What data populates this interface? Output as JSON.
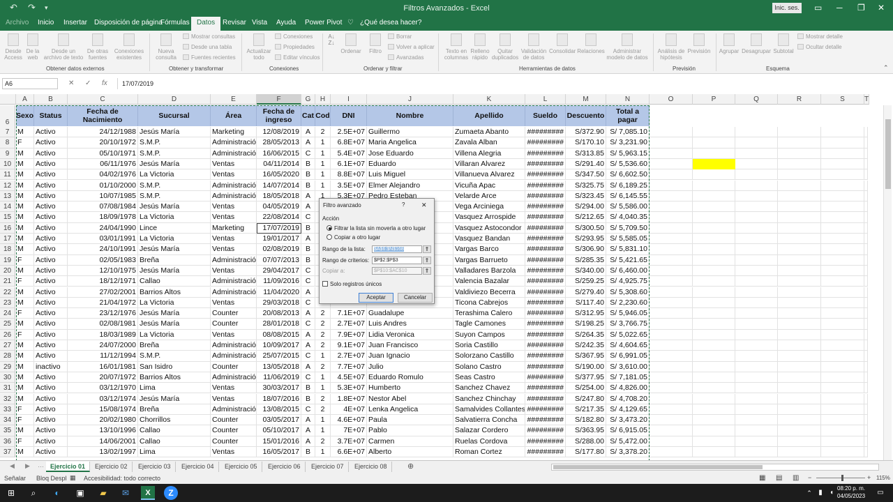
{
  "app": {
    "title": "Filtros Avanzados - Excel",
    "signin": "Inic. ses."
  },
  "tabs": [
    "Archivo",
    "Inicio",
    "Insertar",
    "Disposición de página",
    "Fórmulas",
    "Datos",
    "Revisar",
    "Vista",
    "Ayuda",
    "Power Pivot",
    "¿Qué desea hacer?"
  ],
  "ribbon": {
    "groups": {
      "g1": "Obtener datos externos",
      "g2": "Obtener y transformar",
      "g3": "Conexiones",
      "g4": "Ordenar y filtrar",
      "g5": "Herramientas de datos",
      "g6": "Previsión",
      "g7": "Esquema"
    },
    "btns": {
      "b1": "Desde Access",
      "b2": "De la web",
      "b3": "Desde un archivo de texto",
      "b4": "De otras fuentes",
      "b5": "Conexiones existentes",
      "b6": "Nueva consulta",
      "b7": "Mostrar consultas",
      "b8": "Desde una tabla",
      "b9": "Fuentes recientes",
      "b10": "Actualizar todo",
      "b11": "Conexiones",
      "b12": "Propiedades",
      "b13": "Editar vínculos",
      "b14": "Ordenar",
      "b15": "Filtro",
      "b16": "Borrar",
      "b17": "Volver a aplicar",
      "b18": "Avanzadas",
      "b19": "Texto en columnas",
      "b20": "Relleno rápido",
      "b21": "Quitar duplicados",
      "b22": "Validación de datos",
      "b23": "Consolidar",
      "b24": "Relaciones",
      "b25": "Administrar modelo de datos",
      "b26": "Análisis de hipótesis",
      "b27": "Previsión",
      "b28": "Agrupar",
      "b29": "Desagrupar",
      "b30": "Subtotal",
      "b31": "Mostrar detalle",
      "b32": "Ocultar detalle"
    }
  },
  "formula": {
    "namebox": "A6",
    "fx": "fx",
    "value": "17/07/2019"
  },
  "columns": [
    "A",
    "B",
    "C",
    "D",
    "E",
    "F",
    "G",
    "H",
    "I",
    "J",
    "K",
    "L",
    "M",
    "N",
    "O",
    "P",
    "Q",
    "R",
    "S",
    "T"
  ],
  "headers": [
    "Sexo",
    "Status",
    "Fecha de Nacimiento",
    "Sucursal",
    "Área",
    "Fecha de ingreso",
    "Cat",
    "Cod",
    "DNI",
    "Nombre",
    "Apellido",
    "Sueldo",
    "Descuento",
    "Total a pagar"
  ],
  "rows": [
    [
      "M",
      "Activo",
      "24/12/1988",
      "Jesús María",
      "Marketing",
      "12/08/2019",
      "A",
      "2",
      "2.5E+07",
      "Guillermo",
      "Zumaeta Abanto",
      "#########",
      "S/372.90",
      "S/ 7,085.10"
    ],
    [
      "F",
      "Activo",
      "20/10/1972",
      "S.M.P.",
      "Administración",
      "28/05/2013",
      "A",
      "1",
      "6.8E+07",
      "Maria Angelica",
      "Zavala Alban",
      "#########",
      "S/170.10",
      "S/ 3,231.90"
    ],
    [
      "M",
      "Activo",
      "05/10/1971",
      "S.M.P.",
      "Administración",
      "16/06/2015",
      "C",
      "1",
      "5.4E+07",
      "Jose Eduardo",
      "Villena Alegria",
      "#########",
      "S/313.85",
      "S/ 5,963.15"
    ],
    [
      "M",
      "Activo",
      "06/11/1976",
      "Jesús María",
      "Ventas",
      "04/11/2014",
      "B",
      "1",
      "6.1E+07",
      "Eduardo",
      "Villaran Alvarez",
      "#########",
      "S/291.40",
      "S/ 5,536.60"
    ],
    [
      "M",
      "Activo",
      "04/02/1976",
      "La Victoria",
      "Ventas",
      "16/05/2020",
      "B",
      "1",
      "8.8E+07",
      "Luis Miguel",
      "Villanueva Alvarez",
      "#########",
      "S/347.50",
      "S/ 6,602.50"
    ],
    [
      "M",
      "Activo",
      "01/10/2000",
      "S.M.P.",
      "Administración",
      "14/07/2014",
      "B",
      "1",
      "3.5E+07",
      "Elmer Alejandro",
      "Vicuña Apac",
      "#########",
      "S/325.75",
      "S/ 6,189.25"
    ],
    [
      "M",
      "Activo",
      "10/07/1985",
      "S.M.P.",
      "Administración",
      "18/05/2018",
      "A",
      "1",
      "5.3E+07",
      "Pedro Esteban",
      "Velarde Arce",
      "#########",
      "S/323.45",
      "S/ 6,145.55"
    ],
    [
      "M",
      "Activo",
      "07/08/1984",
      "Jesús María",
      "Ventas",
      "04/05/2019",
      "A",
      "",
      "",
      "",
      "Vega Arciniega",
      "#########",
      "S/294.00",
      "S/ 5,586.00"
    ],
    [
      "M",
      "Activo",
      "18/09/1978",
      "La Victoria",
      "Ventas",
      "22/08/2014",
      "C",
      "",
      "",
      "",
      "Vasquez Arrospide",
      "#########",
      "S/212.65",
      "S/ 4,040.35"
    ],
    [
      "M",
      "Activo",
      "24/04/1990",
      "Lince",
      "Marketing",
      "17/07/2019",
      "B",
      "",
      "",
      "",
      "Vasquez Astocondor",
      "#########",
      "S/300.50",
      "S/ 5,709.50"
    ],
    [
      "M",
      "Activo",
      "03/01/1991",
      "La Victoria",
      "Ventas",
      "19/01/2017",
      "A",
      "",
      "",
      "",
      "Vasquez Bandan",
      "#########",
      "S/293.95",
      "S/ 5,585.05"
    ],
    [
      "M",
      "Activo",
      "24/10/1991",
      "Jesús María",
      "Ventas",
      "02/08/2019",
      "B",
      "",
      "",
      "",
      "Vargas Barco",
      "#########",
      "S/306.90",
      "S/ 5,831.10"
    ],
    [
      "F",
      "Activo",
      "02/05/1983",
      "Breña",
      "Administración",
      "07/07/2013",
      "B",
      "",
      "",
      "",
      "Vargas Barrueto",
      "#########",
      "S/285.35",
      "S/ 5,421.65"
    ],
    [
      "M",
      "Activo",
      "12/10/1975",
      "Jesús María",
      "Ventas",
      "29/04/2017",
      "C",
      "",
      "",
      "",
      "Valladares Barzola",
      "#########",
      "S/340.00",
      "S/ 6,460.00"
    ],
    [
      "F",
      "Activo",
      "18/12/1971",
      "Callao",
      "Administración",
      "11/09/2016",
      "C",
      "",
      "",
      "",
      "Valencia Bazalar",
      "#########",
      "S/259.25",
      "S/ 4,925.75"
    ],
    [
      "M",
      "Activo",
      "27/02/2001",
      "Barrios Altos",
      "Administración",
      "11/04/2020",
      "A",
      "",
      "",
      "",
      "Valdiviezo Becerra",
      "#########",
      "S/279.40",
      "S/ 5,308.60"
    ],
    [
      "M",
      "Activo",
      "21/04/1972",
      "La Victoria",
      "Ventas",
      "29/03/2018",
      "C",
      "",
      "",
      "",
      "Ticona Cabrejos",
      "#########",
      "S/117.40",
      "S/ 2,230.60"
    ],
    [
      "F",
      "Activo",
      "23/12/1976",
      "Jesús María",
      "Counter",
      "20/08/2013",
      "A",
      "2",
      "7.1E+07",
      "Guadalupe",
      "Terashima Calero",
      "#########",
      "S/312.95",
      "S/ 5,946.05"
    ],
    [
      "M",
      "Activo",
      "02/08/1981",
      "Jesús María",
      "Counter",
      "28/01/2018",
      "C",
      "2",
      "2.7E+07",
      "Luis Andres",
      "Tagle Camones",
      "#########",
      "S/198.25",
      "S/ 3,766.75"
    ],
    [
      "F",
      "Activo",
      "18/03/1989",
      "La Victoria",
      "Ventas",
      "08/08/2015",
      "A",
      "2",
      "7.9E+07",
      "Lidia Veronica",
      "Suyon Campos",
      "#########",
      "S/264.35",
      "S/ 5,022.65"
    ],
    [
      "M",
      "Activo",
      "24/07/2000",
      "Breña",
      "Administración",
      "10/09/2017",
      "A",
      "2",
      "9.1E+07",
      "Juan Francisco",
      "Soria Castillo",
      "#########",
      "S/242.35",
      "S/ 4,604.65"
    ],
    [
      "M",
      "Activo",
      "11/12/1994",
      "S.M.P.",
      "Administración",
      "25/07/2015",
      "C",
      "1",
      "2.7E+07",
      "Juan Ignacio",
      "Solorzano Castillo",
      "#########",
      "S/367.95",
      "S/ 6,991.05"
    ],
    [
      "M",
      "inactivo",
      "16/01/1981",
      "San Isidro",
      "Counter",
      "13/05/2018",
      "A",
      "2",
      "7.7E+07",
      "Julio",
      "Solano Castro",
      "#########",
      "S/190.00",
      "S/ 3,610.00"
    ],
    [
      "M",
      "Activo",
      "20/07/1972",
      "Barrios Altos",
      "Administración",
      "11/06/2019",
      "C",
      "1",
      "4.5E+07",
      "Eduardo Romulo",
      "Seas Castro",
      "#########",
      "S/377.95",
      "S/ 7,181.05"
    ],
    [
      "M",
      "Activo",
      "03/12/1970",
      "Lima",
      "Ventas",
      "30/03/2017",
      "B",
      "1",
      "5.3E+07",
      "Humberto",
      "Sanchez Chavez",
      "#########",
      "S/254.00",
      "S/ 4,826.00"
    ],
    [
      "M",
      "Activo",
      "03/12/1974",
      "Jesús María",
      "Ventas",
      "18/07/2016",
      "B",
      "2",
      "1.8E+07",
      "Nestor Abel",
      "Sanchez Chinchay",
      "#########",
      "S/247.80",
      "S/ 4,708.20"
    ],
    [
      "F",
      "Activo",
      "15/08/1974",
      "Breña",
      "Administración",
      "13/08/2015",
      "C",
      "2",
      "4E+07",
      "Lenka Angelica",
      "Samalvides Collantes",
      "#########",
      "S/217.35",
      "S/ 4,129.65"
    ],
    [
      "F",
      "Activo",
      "20/02/1980",
      "Chorrillos",
      "Counter",
      "03/05/2017",
      "A",
      "1",
      "4.6E+07",
      "Paula",
      "Salvatierra Concha",
      "#########",
      "S/182.80",
      "S/ 3,473.20"
    ],
    [
      "M",
      "Activo",
      "13/10/1996",
      "Callao",
      "Counter",
      "05/10/2017",
      "A",
      "1",
      "7E+07",
      "Pablo",
      "Salazar Cordero",
      "#########",
      "S/363.95",
      "S/ 6,915.05"
    ],
    [
      "F",
      "Activo",
      "14/06/2001",
      "Callao",
      "Counter",
      "15/01/2016",
      "A",
      "2",
      "3.7E+07",
      "Carmen",
      "Ruelas Cordova",
      "#########",
      "S/288.00",
      "S/ 5,472.00"
    ],
    [
      "M",
      "Activo",
      "13/02/1997",
      "Lima",
      "Ventas",
      "16/05/2017",
      "B",
      "1",
      "6.6E+07",
      "Alberto",
      "Roman Cortez",
      "#########",
      "S/177.80",
      "S/ 3,378.20"
    ]
  ],
  "dialog": {
    "title": "Filtro avanzado",
    "help": "?",
    "close": "✕",
    "section": "Acción",
    "opt1": "Filtrar la lista sin moverla a otro lugar",
    "opt2": "Copiar a otro lugar",
    "lbl_list": "Rango de la lista:",
    "val_list": "$A$6:$N$168",
    "lbl_crit": "Rango de criterios:",
    "val_crit": "$P$2:$P$3",
    "lbl_copy": "Copiar a:",
    "val_copy": "$P$10:$AC$10",
    "unique": "Solo registros únicos",
    "ok": "Aceptar",
    "cancel": "Cancelar"
  },
  "sheets": [
    "Ejercicio 01",
    "Ejercicio 02",
    "Ejercicio 03",
    "Ejercicio 04",
    "Ejercicio 05",
    "Ejercicio 06",
    "Ejercicio 07",
    "Ejercicio 08"
  ],
  "status": {
    "mode": "Señalar",
    "scroll": "Bloq Despl",
    "access": "Accesibilidad: todo correcto",
    "zoom": "115%"
  },
  "taskbar": {
    "time": "08:20 p. m.",
    "date": "04/05/2023"
  },
  "colors": {
    "excel_green": "#217346",
    "header_fill": "#b4c7e7",
    "highlight": "#ffff00"
  }
}
